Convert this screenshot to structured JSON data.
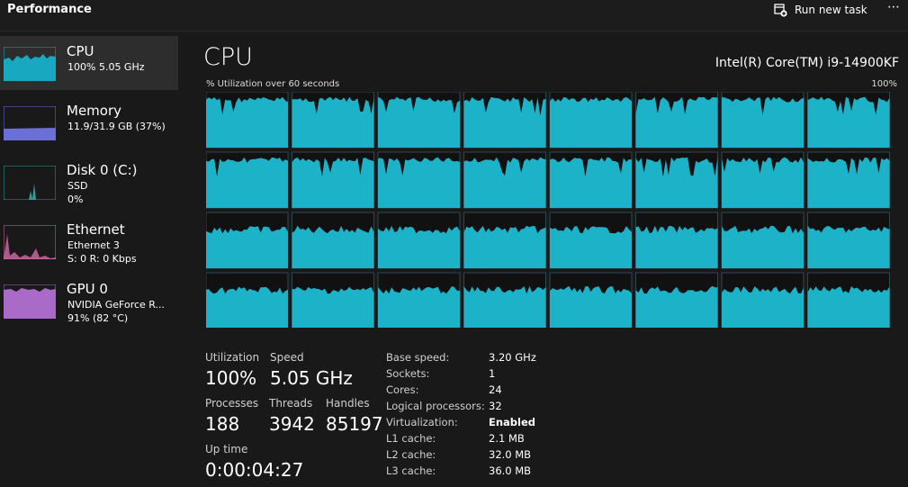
{
  "header": {
    "title": "Performance",
    "run_new_task": "Run new task",
    "more": "⋯"
  },
  "sidebar": {
    "items": [
      {
        "name": "CPU",
        "sub1": "100%  5.05 GHz",
        "sub2": "",
        "color": "#18a8c0"
      },
      {
        "name": "Memory",
        "sub1": "11.9/31.9 GB (37%)",
        "sub2": "",
        "color": "#6b70d8"
      },
      {
        "name": "Disk 0 (C:)",
        "sub1": "SSD",
        "sub2": "0%",
        "color": "#2aa09a"
      },
      {
        "name": "Ethernet",
        "sub1": "Ethernet 3",
        "sub2": "S: 0 R: 0 Kbps",
        "color": "#d26aa8"
      },
      {
        "name": "GPU 0",
        "sub1": "NVIDIA GeForce R...",
        "sub2": "91% (82 °C)",
        "color": "#a96ac8"
      }
    ]
  },
  "main": {
    "title": "CPU",
    "model": "Intel(R) Core(TM) i9-14900KF",
    "graph_label": "% Utilization over 60 seconds",
    "graph_max": "100%",
    "graph_color": "#1cb3c9",
    "logical_processor_graphs": 32
  },
  "stats": {
    "utilization_label": "Utilization",
    "utilization_value": "100%",
    "speed_label": "Speed",
    "speed_value": "5.05 GHz",
    "processes_label": "Processes",
    "processes_value": "188",
    "threads_label": "Threads",
    "threads_value": "3942",
    "handles_label": "Handles",
    "handles_value": "85197",
    "uptime_label": "Up time",
    "uptime_value": "0:00:04:27"
  },
  "specs": [
    {
      "label": "Base speed:",
      "value": "3.20 GHz"
    },
    {
      "label": "Sockets:",
      "value": "1"
    },
    {
      "label": "Cores:",
      "value": "24"
    },
    {
      "label": "Logical processors:",
      "value": "32"
    },
    {
      "label": "Virtualization:",
      "value": "Enabled"
    },
    {
      "label": "L1 cache:",
      "value": "2.1 MB"
    },
    {
      "label": "L2 cache:",
      "value": "32.0 MB"
    },
    {
      "label": "L3 cache:",
      "value": "36.0 MB"
    }
  ]
}
